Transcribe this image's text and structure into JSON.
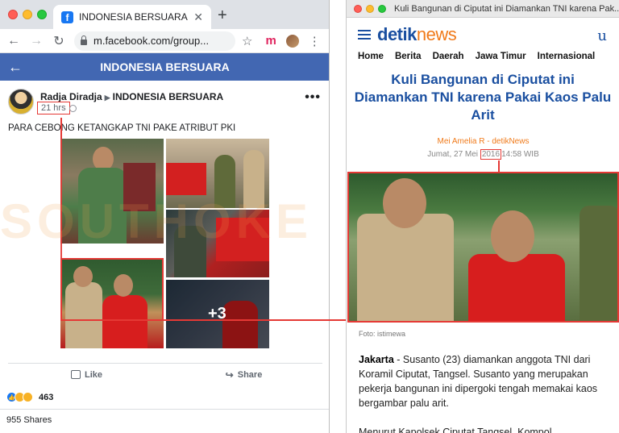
{
  "left_window": {
    "tab_title": "INDONESIA BERSUARA",
    "url": "m.facebook.com/group...",
    "header_title": "INDONESIA BERSUARA",
    "post": {
      "author": "Radja Diradja",
      "group": "INDONESIA BERSUARA",
      "time": "21 hrs",
      "text": "PARA CEBONG KETANGKAP TNI PAKE ATRIBUT PKI",
      "more_photos": "+3",
      "like_label": "Like",
      "share_label": "Share",
      "reaction_count": "463",
      "shares": "955 Shares"
    }
  },
  "right_window": {
    "window_title": "Kuli Bangunan di Ciputat ini Diamankan TNI karena Pak...",
    "logo_detik": "detik",
    "logo_news": "news",
    "nav": [
      "Home",
      "Berita",
      "Daerah",
      "Jawa Timur",
      "Internasional"
    ],
    "headline": "Kuli Bangunan di Ciputat ini Diamankan TNI karena Pakai Kaos Palu Arit",
    "byline": "Mei Amelia R - detikNews",
    "date_prefix": "Jumat, 27 Mei",
    "date_year": "2016",
    "date_suffix": "14:58 WIB",
    "caption": "Foto: istimewa",
    "body_lead": "Jakarta",
    "body_text": " - Susanto (23) diamankan anggota TNI dari Koramil Ciputat, Tangsel. Susanto yang merupakan pekerja bangunan ini dipergoki tengah memakai kaos bergambar palu arit.",
    "body_text2": "Menurut Kapolsek Ciputat Tangsel, Kompol"
  },
  "watermark": "SOUTHOKE",
  "colors": {
    "fb_blue": "#4267b2",
    "detik_blue": "#1a4fa0",
    "detik_orange": "#f07a1a",
    "highlight_red": "#e53935"
  }
}
